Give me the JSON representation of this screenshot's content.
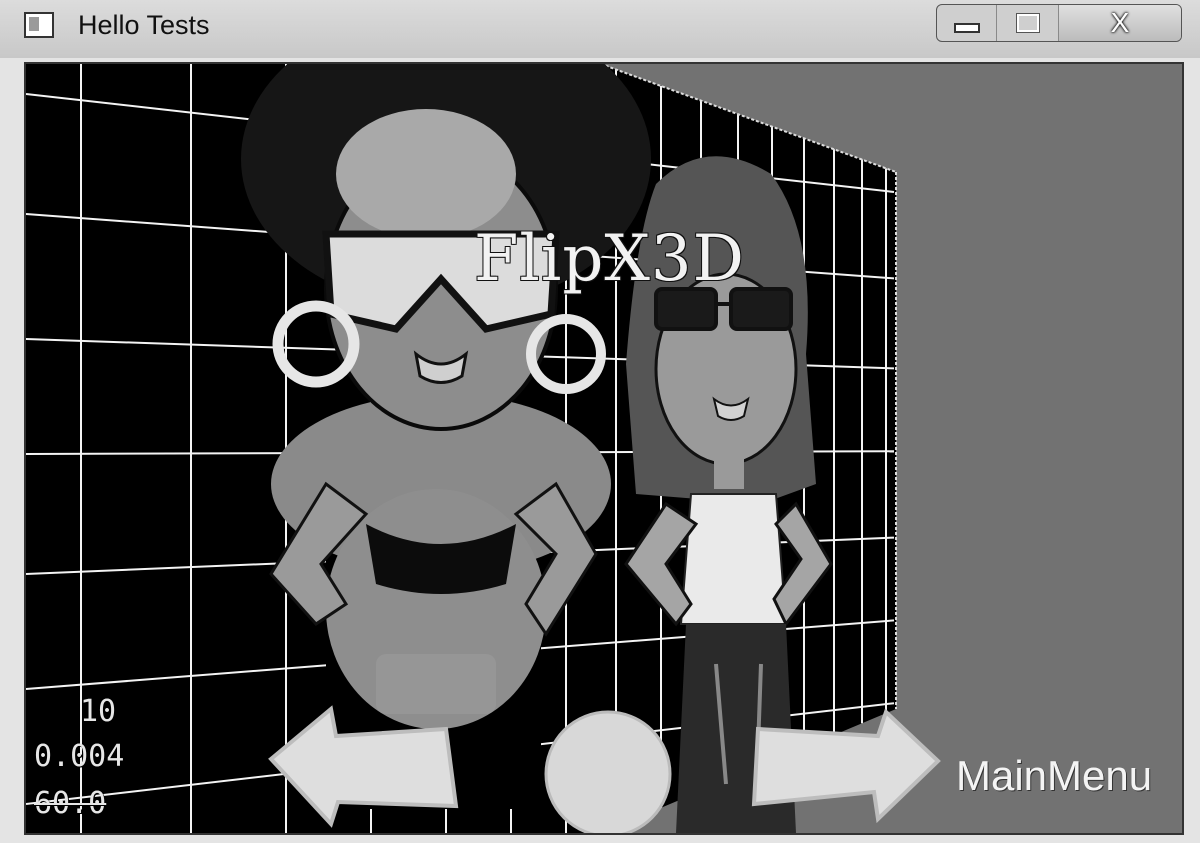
{
  "window": {
    "title": "Hello Tests",
    "controls": {
      "minimize": "",
      "maximize": "",
      "close": "X"
    }
  },
  "scene": {
    "title": "FlipX3D",
    "stats": {
      "objects": "10",
      "seconds_per_frame": "0.004",
      "fps": "60.0"
    },
    "menu_label": "MainMenu",
    "nav": {
      "back": "left-arrow-icon",
      "restart": "circle-button-icon",
      "next": "right-arrow-icon"
    },
    "colors": {
      "background": "#000000",
      "grid": "#ffffff",
      "flipped_area": "#707070"
    }
  }
}
